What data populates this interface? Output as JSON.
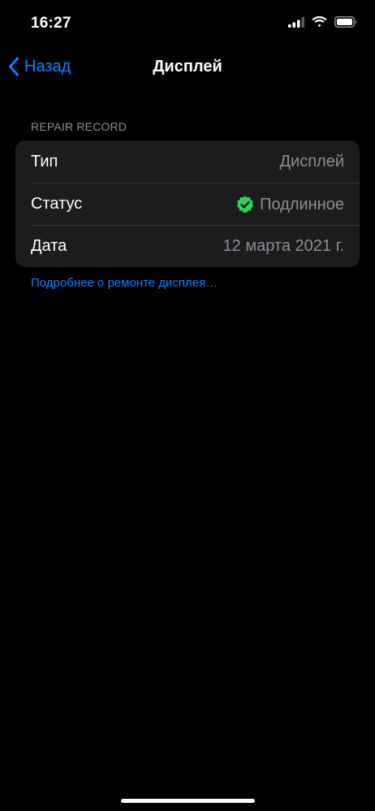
{
  "status_bar": {
    "time": "16:27",
    "icons": [
      "signal-icon",
      "wifi-icon",
      "battery-icon"
    ]
  },
  "nav": {
    "back_label": "Назад",
    "title": "Дисплей"
  },
  "section": {
    "header": "REPAIR RECORD"
  },
  "rows": [
    {
      "label": "Тип",
      "value": "Дисплей"
    },
    {
      "label": "Статус",
      "value": "Подлинное",
      "icon": "verified-check-icon"
    },
    {
      "label": "Дата",
      "value": "12 марта 2021 г."
    }
  ],
  "link": {
    "label": "Подробнее о ремонте дисплея…"
  },
  "colors": {
    "background": "#000000",
    "group_background": "#1c1c1e",
    "accent": "#0a84ff",
    "secondary_text": "#8e8e93",
    "verified_green": "#30d158",
    "separator": "#38383a"
  }
}
